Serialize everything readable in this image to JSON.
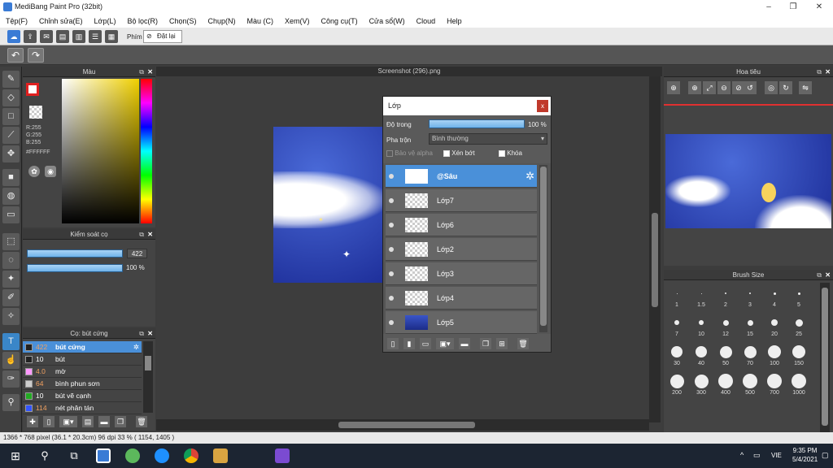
{
  "app": {
    "title": "MediBang Paint Pro (32bit)"
  },
  "menu": [
    "Tệp(F)",
    "Chỉnh sửa(E)",
    "Lớp(L)",
    "Bộ lọc(R)",
    "Chọn(S)",
    "Chụp(N)",
    "Màu (C)",
    "Xem(V)",
    "Công cụ(T)",
    "Cửa sổ(W)",
    "Cloud",
    "Help"
  ],
  "toolbar1": {
    "key_label": "Phím",
    "reset_label": "Đặt lại"
  },
  "color_panel": {
    "title": "Màu",
    "r": "R:255",
    "g": "G:255",
    "b": "B:255",
    "hex": "#FFFFFF"
  },
  "brush_control": {
    "title": "Kiểm soát cọ",
    "size": "422",
    "opacity": "100 %",
    "size_fill": 1.0,
    "opacity_fill": 1.0
  },
  "brush_list": {
    "title": "Cọ: bút cứng",
    "items": [
      {
        "num": "422",
        "name": "bút cứng",
        "color": "#222222"
      },
      {
        "num": "10",
        "name": "bút",
        "color": "#222222"
      },
      {
        "num": "4.0",
        "name": "mờ",
        "color": "#ff99ff"
      },
      {
        "num": "64",
        "name": "bình phun sơn",
        "color": "#cccccc"
      },
      {
        "num": "10",
        "name": "bút vẽ cạnh",
        "color": "#22aa22"
      },
      {
        "num": "114",
        "name": "nét phân tán",
        "color": "#3355ff"
      }
    ]
  },
  "canvas": {
    "doc_title": "Screenshot (296).png"
  },
  "layer_panel": {
    "title": "Lớp",
    "close": "x",
    "opacity_label": "Độ trong",
    "opacity_value": "100 %",
    "blend_label": "Pha trộn",
    "blend_value": "Bình thường",
    "protect_alpha": "Bảo vệ alpha",
    "clip": "Xén bớt",
    "lock": "Khóa",
    "layers": [
      "@Sâu",
      "Lớp7",
      "Lớp6",
      "Lớp2",
      "Lớp3",
      "Lớp4",
      "Lớp5"
    ]
  },
  "navigator": {
    "title": "Hoa tiêu"
  },
  "brush_size": {
    "title": "Brush Size",
    "sizes": [
      "1",
      "1.5",
      "2",
      "3",
      "4",
      "5",
      "7",
      "10",
      "12",
      "15",
      "20",
      "25",
      "30",
      "40",
      "50",
      "70",
      "100",
      "150",
      "200",
      "300",
      "400",
      "500",
      "700",
      "1000"
    ]
  },
  "status": {
    "text": "1366 * 768 pixel   (36.1 * 20.3cm)   96 dpi   33 %   ( 1154, 1405 )"
  },
  "taskbar": {
    "lang": "VIE",
    "time": "9:35 PM",
    "date": "5/4/2021"
  }
}
